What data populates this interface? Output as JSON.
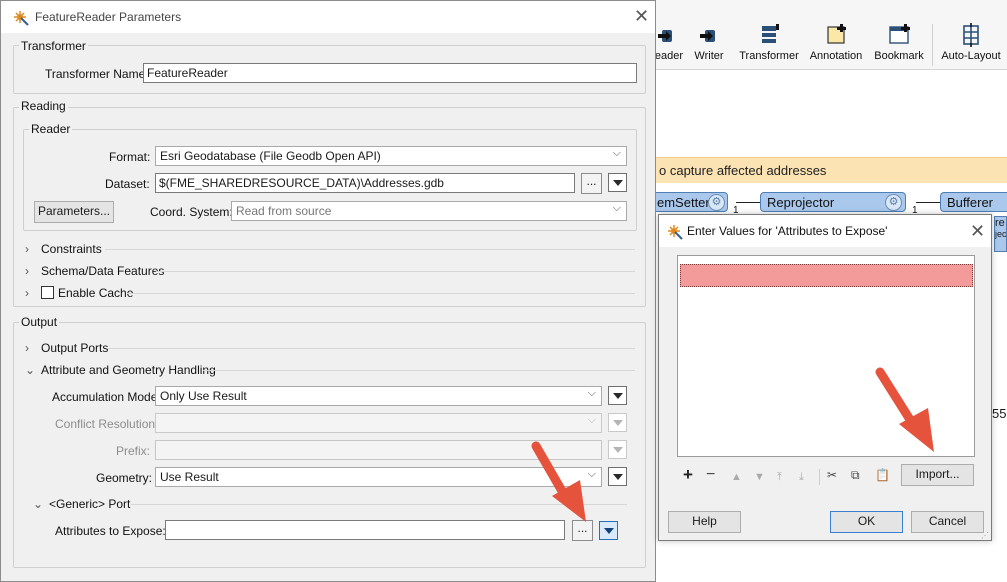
{
  "toolbar": {
    "buttons": [
      {
        "label": "eader",
        "icon": "reader-icon"
      },
      {
        "label": "Writer",
        "icon": "writer-icon"
      },
      {
        "label": "Transformer",
        "icon": "transformer-icon"
      },
      {
        "label": "Annotation",
        "icon": "annotation-icon"
      },
      {
        "label": "Bookmark",
        "icon": "bookmark-icon"
      },
      {
        "label": "Auto-Layout",
        "icon": "auto-layout-icon"
      }
    ]
  },
  "canvas": {
    "annotation_text": "o capture affected addresses",
    "nodes": [
      {
        "label": "emSetter"
      },
      {
        "label": "Reprojector"
      },
      {
        "label": "Bufferer"
      }
    ],
    "port_numbers": [
      "1",
      "1"
    ],
    "partial_node_texts": [
      "re",
      "jec"
    ],
    "partial_number": "55"
  },
  "main_dialog": {
    "title": "FeatureReader Parameters",
    "transformer": {
      "section_label": "Transformer",
      "name_label": "Transformer Name:",
      "name_value": "FeatureReader"
    },
    "reading": {
      "section_label": "Reading",
      "reader_label": "Reader",
      "format_label": "Format:",
      "format_value": "Esri Geodatabase (File Geodb Open API)",
      "dataset_label": "Dataset:",
      "dataset_value": "$(FME_SHAREDRESOURCE_DATA)\\Addresses.gdb",
      "parameters_button": "Parameters...",
      "coord_label": "Coord. System:",
      "coord_placeholder": "Read from source",
      "constraints_label": "Constraints",
      "schema_label": "Schema/Data Features",
      "cache_label": "Enable Cache"
    },
    "output": {
      "section_label": "Output",
      "ports_label": "Output Ports",
      "attr_geom_label": "Attribute and Geometry Handling",
      "accumulation_label": "Accumulation Mode:",
      "accumulation_value": "Only Use Result",
      "conflict_label": "Conflict Resolution:",
      "prefix_label": "Prefix:",
      "geometry_label": "Geometry:",
      "geometry_value": "Use Result",
      "generic_port_label": "<Generic> Port",
      "expose_label": "Attributes to Expose:",
      "expose_value": ""
    }
  },
  "expose_dialog": {
    "title": "Enter Values for 'Attributes to Expose'",
    "import_button": "Import...",
    "help_button": "Help",
    "ok_button": "OK",
    "cancel_button": "Cancel"
  },
  "colors": {
    "annotation_bg": "#fbe3b3",
    "node_fill": "#a9c8ec",
    "selected_row": "#f39a9a",
    "arrow": "#e5533d"
  }
}
